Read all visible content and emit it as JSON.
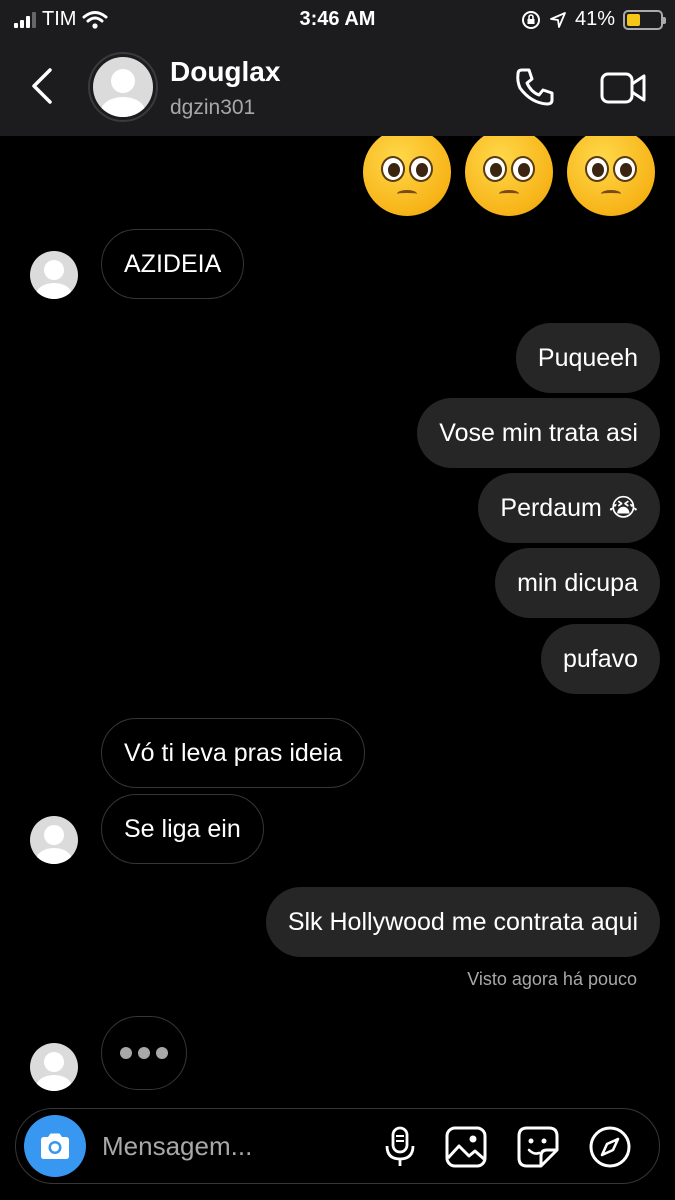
{
  "status_bar": {
    "carrier": "TIM",
    "time": "3:46 AM",
    "battery_percent": "41%",
    "battery_level": 0.41,
    "icons": [
      "signal-icon",
      "wifi-icon",
      "orientation-lock-icon",
      "location-icon",
      "battery-icon"
    ]
  },
  "header": {
    "name": "Douglax",
    "username": "dgzin301",
    "icons": [
      "back-icon",
      "phone-icon",
      "video-icon"
    ]
  },
  "messages": {
    "emoji_reaction": [
      "🥺",
      "🥺",
      "🥺"
    ],
    "m1": "AZIDEIA",
    "m2": "Puqueeh",
    "m3": "Vose min trata asi",
    "m4": "Perdaum 😭",
    "m5": "min dicupa",
    "m6": "pufavo",
    "m7": "Vó ti leva pras ideia",
    "m8": "Se liga ein",
    "m9": "Slk Hollywood me contrata aqui",
    "seen": "Visto agora há pouco"
  },
  "composer": {
    "placeholder": "Mensagem...",
    "icons": [
      "camera-icon",
      "microphone-icon",
      "gallery-icon",
      "sticker-icon",
      "compass-icon"
    ]
  },
  "colors": {
    "accent": "#3897f0",
    "outgoing_bubble": "#262626",
    "incoming_border": "#363636",
    "battery": "#f5c518"
  }
}
